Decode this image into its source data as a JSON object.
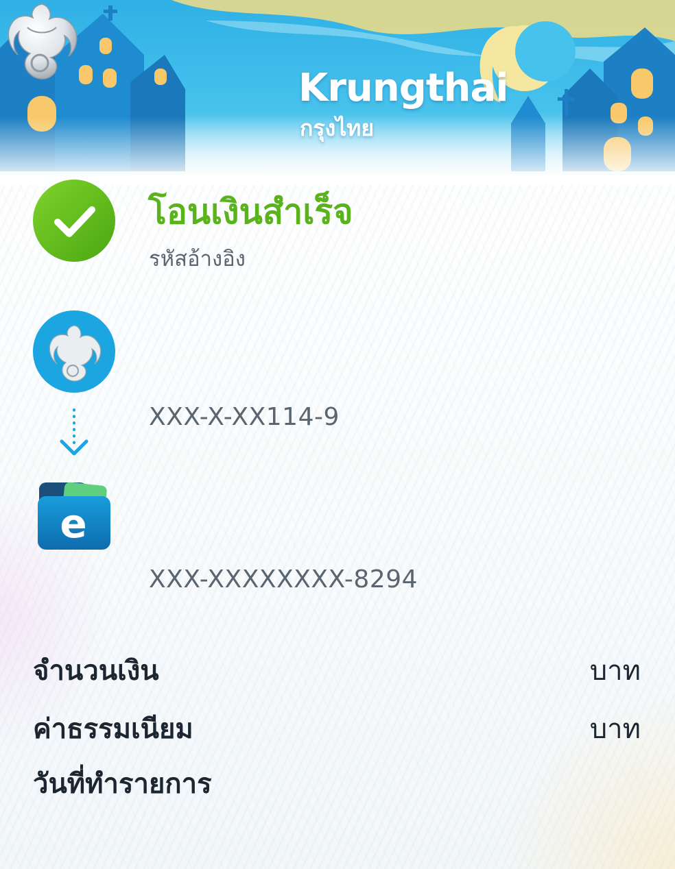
{
  "brand": {
    "name_en": "Krungthai",
    "name_th": "กรุงไทย"
  },
  "status": {
    "title": "โอนเงินสำเร็จ",
    "reference_label": "รหัสอ้างอิง",
    "color": "#5ab31a"
  },
  "from": {
    "account_masked": "XXX-X-XX114-9",
    "bank_color": "#1ba5e1"
  },
  "to": {
    "account_masked": "XXX-XXXXXXXX-8294"
  },
  "details": {
    "amount_label": "จำนวนเงิน",
    "amount_unit": "บาท",
    "fee_label": "ค่าธรรมเนียม",
    "fee_unit": "บาท",
    "date_label": "วันที่ทำรายการ"
  },
  "icons": {
    "logo": "krungthai-bird-logo-icon",
    "success": "check-circle-icon",
    "from_bank": "krungthai-bank-icon",
    "arrow": "arrow-down-icon",
    "to_wallet": "e-wallet-icon"
  }
}
